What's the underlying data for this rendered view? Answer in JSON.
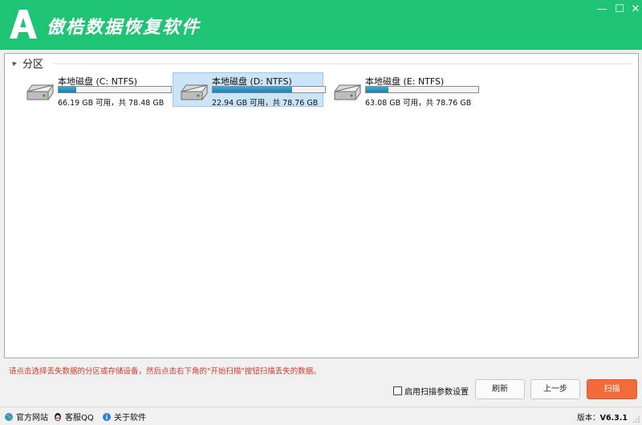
{
  "window": {
    "title": "傲梏数据恢复软件",
    "brand_color": "#1fc474",
    "controls": {
      "minimize": "—",
      "maximize": "☐",
      "close": "✕"
    }
  },
  "section": {
    "title": "分区"
  },
  "drives": [
    {
      "name": "本地磁盘 (C: NTFS)",
      "free": "66.19 GB 可用，共 78.48 GB",
      "used_fraction": 0.16,
      "selected": false
    },
    {
      "name": "本地磁盘 (D: NTFS)",
      "free": "22.94 GB 可用，共 78.76 GB",
      "used_fraction": 0.71,
      "selected": true
    },
    {
      "name": "本地磁盘 (E: NTFS)",
      "free": "63.08 GB 可用，共 78.76 GB",
      "used_fraction": 0.2,
      "selected": false
    }
  ],
  "hint": "请点击选择丢失数据的分区或存储设备，然后点击右下角的\"开始扫描\"按钮扫描丢失的数据。",
  "options": {
    "scan_params_label": "启用扫描参数设置",
    "checked": false
  },
  "buttons": {
    "refresh": "刷新",
    "back": "上一步",
    "scan": "扫描"
  },
  "accent_color": "#f06a3a",
  "statusbar": {
    "website": "官方网站",
    "qq": "客服QQ",
    "about": "关于软件",
    "version_label": "版本：",
    "version_value": "V6.3.1"
  }
}
